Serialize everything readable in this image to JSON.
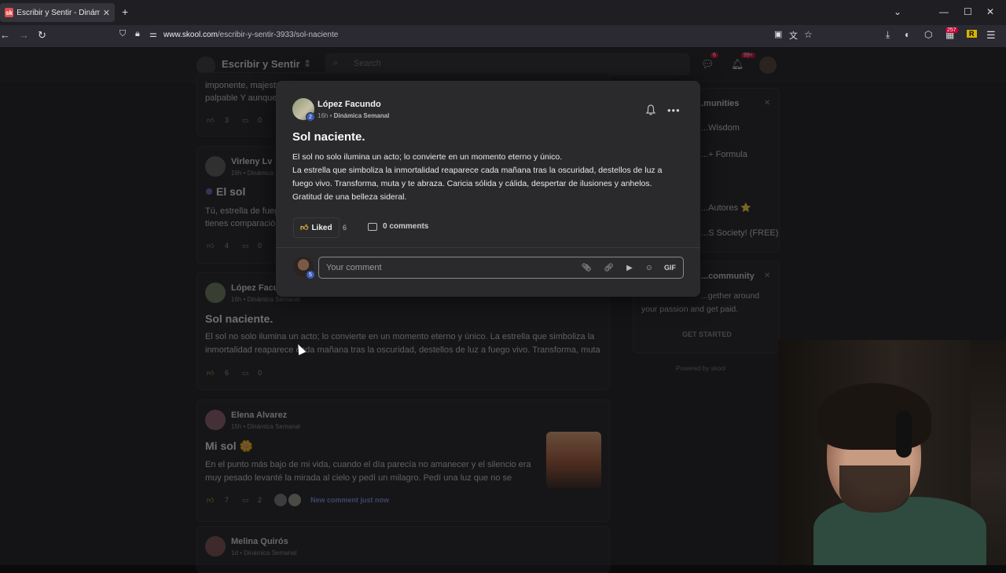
{
  "browser": {
    "tab_title": "Escribir y Sentir - Dinámica Semanal",
    "favicon_text": "sk",
    "url_domain": "www.skool.com",
    "url_path": "/escribir-y-sentir-3933/sol-naciente",
    "ext_badge_count": "257",
    "ext_r_label": "R"
  },
  "site": {
    "community_name": "Escribir y Sentir",
    "search_placeholder": "Search",
    "chat_badge": "6",
    "notif_badge": "99+"
  },
  "feed": {
    "post0_text_1": "imponente, majestuoso...",
    "post0_text_2": "palpable Y aunque...",
    "post0_likes": "3",
    "post0_comments": "0",
    "post1_author": "Virleny Lv",
    "post1_meta": "16h • Dinámica Semanal",
    "post1_title": "El sol",
    "post1_text_1": "Tú, estrella de fuego...",
    "post1_text_2": "tienes comparación...",
    "post1_likes": "4",
    "post1_comments": "0",
    "post2_author": "López Facundo",
    "post2_meta": "16h • Dinámica Semanal",
    "post2_title": "Sol naciente.",
    "post2_text_1": "El sol no solo ilumina un acto; lo convierte en un momento eterno y único. La estrella que simboliza la",
    "post2_text_2": "inmortalidad reaparece cada mañana tras la oscuridad, destellos de luz a fuego vivo. Transforma, muta",
    "post2_likes": "6",
    "post2_comments": "0",
    "post3_author": "Elena Alvarez",
    "post3_meta": "15h • Dinámica Semanal",
    "post3_title": "Mi sol 🌼",
    "post3_text_1": "En el punto más bajo de mi vida, cuando el día parecía no amanecer y el silencio era",
    "post3_text_2": "muy pesado levanté la mirada al cielo y pedí un milagro. Pedí una luz que no se",
    "post3_likes": "7",
    "post3_comments": "2",
    "post3_new_comment": "New comment just now",
    "post4_author": "Melina Quirós",
    "post4_meta": "1d • Dinámica Semanal"
  },
  "sidebar": {
    "communities_title": "...munities",
    "item1": "...Wisdom",
    "item2": "...+ Formula",
    "item3": "...Autores ⭐",
    "item4": "...S Society! (FREE)",
    "create_title": "...community",
    "create_text_1": "...gether around",
    "create_text_2": "your passion and get paid.",
    "get_started": "GET STARTED",
    "powered_by": "Powered by skool"
  },
  "modal": {
    "author": "López Facundo",
    "level": "2",
    "time": "16h",
    "separator": " • ",
    "category": "Dinámica Semanal",
    "title": "Sol naciente.",
    "line1": "El sol no solo ilumina un acto; lo convierte en un momento eterno y único.",
    "line2": "La estrella que simboliza la inmortalidad reaparece cada mañana tras la oscuridad, destellos de luz a",
    "line3": "fuego vivo. Transforma, muta y te abraza. Caricia sólida y cálida, despertar de ilusiones y anhelos.",
    "line4": "Gratitud de una belleza sideral.",
    "liked_label": "Liked",
    "like_count": "6",
    "comments_label": "0 comments",
    "comment_placeholder": "Your comment",
    "commenter_level": "5",
    "gif_label": "GIF"
  }
}
